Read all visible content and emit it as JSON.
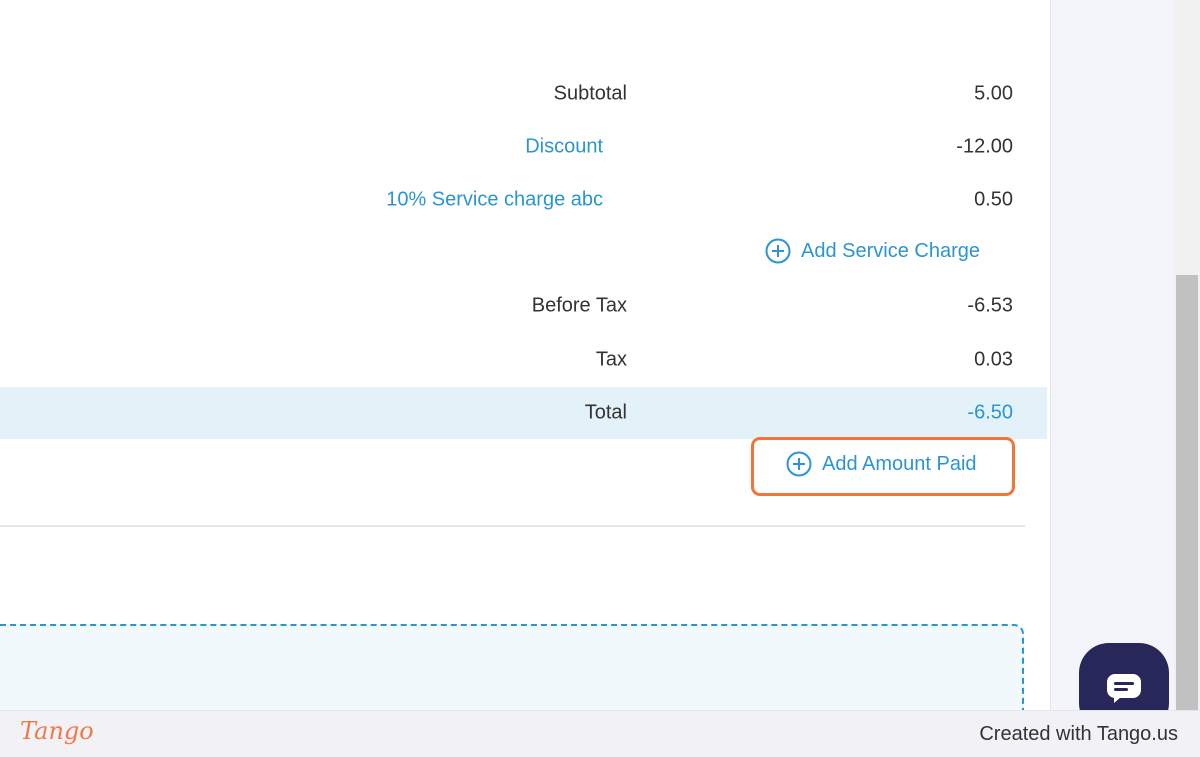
{
  "summary": {
    "subtotal": {
      "label": "Subtotal",
      "value": "5.00"
    },
    "discount": {
      "label": "Discount",
      "value": "-12.00"
    },
    "service_charge": {
      "label": "10% Service charge abc",
      "value": "0.50"
    },
    "add_service_charge_label": "Add Service Charge",
    "before_tax": {
      "label": "Before Tax",
      "value": "-6.53"
    },
    "tax": {
      "label": "Tax",
      "value": "0.03"
    },
    "total": {
      "label": "Total",
      "value": "-6.50"
    },
    "add_amount_paid_label": "Add Amount Paid"
  },
  "footer": {
    "logo": "Tango",
    "credit": "Created with Tango.us"
  },
  "colors": {
    "accent": "#2b95cf",
    "highlight": "#f1743a",
    "total_row_bg": "#e3f1f8",
    "chat_button": "#27275a"
  },
  "icons": {
    "add": "plus-circle-icon",
    "chat": "chat-bubble-icon"
  }
}
